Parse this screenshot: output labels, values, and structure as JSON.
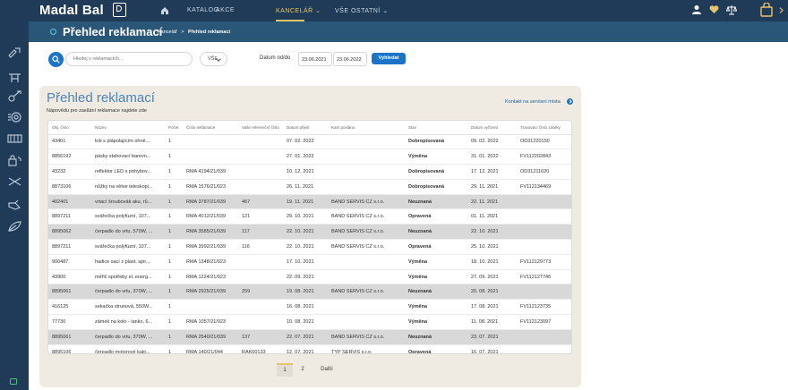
{
  "header": {
    "logo": "Madal Bal",
    "nav": [
      {
        "label": "KATALOG"
      },
      {
        "label": "AKCE"
      },
      {
        "label": "KANCELÁŘ ⌄"
      },
      {
        "label": "VŠE OSTATNÍ ⌄"
      }
    ],
    "active_color": "#e6c46a"
  },
  "titlebar": {
    "title": "Přehled reklamací",
    "breadcrumb": {
      "parent": "Kancelář",
      "separator": ">",
      "current": "Přehled reklamací"
    }
  },
  "search": {
    "placeholder": "Hledej v reklamacích...",
    "filter_value": "VŠE",
    "date_label": "Datum od/do",
    "date_from": "23.06.2021",
    "date_to": "23.06.2022",
    "submit_label": "Vyhledat"
  },
  "panel": {
    "title": "Přehled reklamací",
    "subtitle": "Nápovědu pro zasílání reklamace najdete zde",
    "contact_link": "Kontakt na servisní místa"
  },
  "table": {
    "columns": [
      "Obj. číslo",
      "Název",
      "Počet",
      "Číslo reklamace",
      "Vaše referenční číslo",
      "Datum přijetí",
      "Kam posláno",
      "Stav",
      "Datum vyřízení",
      "Trasovací číslo zásilky"
    ],
    "rows": [
      {
        "obj": "43401",
        "name": "krb s plápolajícím ohně...",
        "qty": "1",
        "rma": "",
        "ref": "",
        "received": "07. 02. 2022",
        "sent_to": "",
        "status": "Dobropisovaná",
        "resolved": "09. 02. 2022",
        "tracking": "OD31220150",
        "grey": false
      },
      {
        "obj": "8856192",
        "name": "pásky stahovací barevn...",
        "qty": "1",
        "rma": "",
        "ref": "",
        "received": "27. 01. 2022",
        "sent_to": "",
        "status": "Výměna",
        "resolved": "31. 01. 2022",
        "tracking": "FV112202843",
        "grey": false
      },
      {
        "obj": "43232",
        "name": "reflektor LED s pohybov...",
        "qty": "1",
        "rma": "RMA 4194/21/039",
        "ref": "",
        "received": "10. 12. 2021",
        "sent_to": "",
        "status": "Dobropisovaná",
        "resolved": "17. 12. 2021",
        "tracking": "OD31211620",
        "grey": false
      },
      {
        "obj": "8873106",
        "name": "nůžky na větve teleskopi...",
        "qty": "1",
        "rma": "RMA 1576/21/023",
        "ref": "",
        "received": "26. 11. 2021",
        "sent_to": "",
        "status": "Dobropisovaná",
        "resolved": "29. 11. 2021",
        "tracking": "FV112134469",
        "grey": false
      },
      {
        "obj": "402401",
        "name": "vrtací šroubovák aku, rů...",
        "qty": "1",
        "rma": "RMA 3787/21/039",
        "ref": "467",
        "received": "19. 11. 2021",
        "sent_to": "BAND SERVIS CZ s.r.o.",
        "status": "Neuznaná",
        "resolved": "22. 11. 2021",
        "tracking": "",
        "grey": true
      },
      {
        "obj": "8897211",
        "name": "svářečka polyfúzní, 107...",
        "qty": "1",
        "rma": "RMA 4012/21/039",
        "ref": "121",
        "received": "29. 10. 2021",
        "sent_to": "BAND SERVIS CZ s.r.o.",
        "status": "Opravená",
        "resolved": "01. 11. 2021",
        "tracking": "",
        "grey": false
      },
      {
        "obj": "8895062",
        "name": "čerpadlo do vrtu, 570W, ...",
        "qty": "1",
        "rma": "RMA 3585/21/039",
        "ref": "117",
        "received": "22. 10. 2021",
        "sent_to": "BAND SERVIS CZ s.r.o.",
        "status": "Neuznaná",
        "resolved": "22. 10. 2021",
        "tracking": "",
        "grey": true
      },
      {
        "obj": "8897211",
        "name": "svářečka polyfúzní, 107...",
        "qty": "1",
        "rma": "RMA 3992/21/039",
        "ref": "116",
        "received": "22. 10. 2021",
        "sent_to": "BAND SERVIS CZ s.r.o.",
        "status": "Opravená",
        "resolved": "25. 10. 2021",
        "tracking": "",
        "grey": false
      },
      {
        "obj": "900487",
        "name": "hadice sací z plast. spir...",
        "qty": "1",
        "rma": "RMA 1348/21/023",
        "ref": "",
        "received": "17. 10. 2021",
        "sent_to": "",
        "status": "Výměna",
        "resolved": "18. 10. 2021",
        "tracking": "FV112129773",
        "grey": false
      },
      {
        "obj": "43900",
        "name": "měřič spotřeby el. energ...",
        "qty": "1",
        "rma": "RMA 1224/21/023",
        "ref": "",
        "received": "22. 09. 2021",
        "sent_to": "",
        "status": "Výměna",
        "resolved": "27. 09. 2021",
        "tracking": "FV112127746",
        "grey": false
      },
      {
        "obj": "8895061",
        "name": "čerpadlo do vrtu, 370W, ...",
        "qty": "1",
        "rma": "RMA 2925/21/039",
        "ref": "259",
        "received": "19. 08. 2021",
        "sent_to": "BAND SERVIS CZ s.r.o.",
        "status": "Neuznaná",
        "resolved": "20. 08. 2021",
        "tracking": "",
        "grey": true
      },
      {
        "obj": "416125",
        "name": "sekačka strunová, 550W...",
        "qty": "1",
        "rma": "",
        "ref": "",
        "received": "16. 08. 2021",
        "sent_to": "",
        "status": "Výměna",
        "resolved": "17. 08. 2021",
        "tracking": "FV112123735",
        "grey": false
      },
      {
        "obj": "77730",
        "name": "zámek na kolo - lanko, 6...",
        "qty": "1",
        "rma": "RMA 1057/21/023",
        "ref": "",
        "received": "10. 08. 2021",
        "sent_to": "",
        "status": "Výměna",
        "resolved": "11. 08. 2021",
        "tracking": "FV112123097",
        "grey": false
      },
      {
        "obj": "8895061",
        "name": "čerpadlo do vrtu, 370W, ...",
        "qty": "1",
        "rma": "RMA 2540/21/039",
        "ref": "137",
        "received": "22. 07. 2021",
        "sent_to": "BAND SERVIS CZ s.r.o.",
        "status": "Neuznaná",
        "resolved": "23. 07. 2021",
        "tracking": "",
        "grey": true
      },
      {
        "obj": "8895106",
        "name": "čerpadlo motorové kalo...",
        "qty": "1",
        "rma": "RMA 140/21/044",
        "ref": "RAK00133",
        "received": "12. 07. 2021",
        "sent_to": "TYP SERVIS s.r.o.",
        "status": "Opravená",
        "resolved": "16. 07. 2021",
        "tracking": "",
        "grey": false
      }
    ]
  },
  "pagination": {
    "pages": [
      "1",
      "2"
    ],
    "active": "1",
    "next_label": "Další"
  },
  "colors": {
    "sidebar": "#1f3b57",
    "titlebar": "#2a5678",
    "accent_blue": "#1b74c7",
    "panel_bg": "#efebe2",
    "highlight_row": "#d8d8d8"
  }
}
